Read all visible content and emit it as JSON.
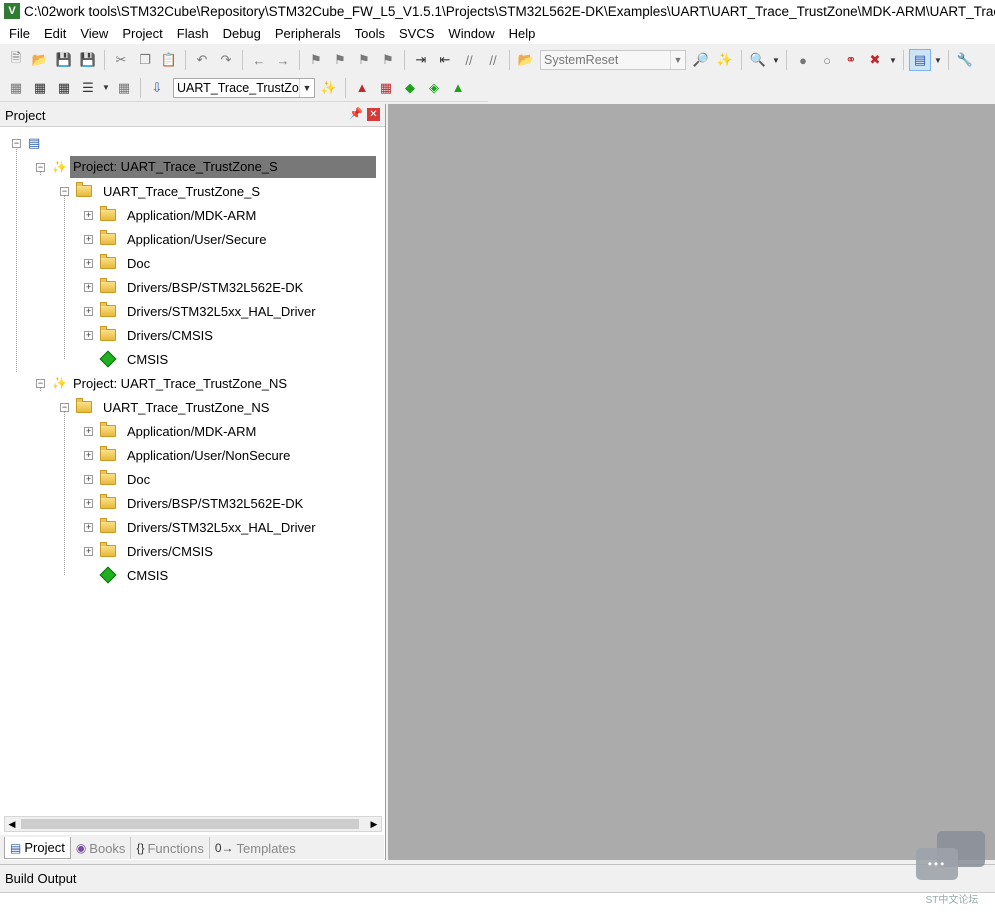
{
  "window": {
    "app_icon_letter": "V",
    "title": "C:\\02work tools\\STM32Cube\\Repository\\STM32Cube_FW_L5_V1.5.1\\Projects\\STM32L562E-DK\\Examples\\UART\\UART_Trace_TrustZone\\MDK-ARM\\UART_Trace"
  },
  "menu": [
    "File",
    "Edit",
    "View",
    "Project",
    "Flash",
    "Debug",
    "Peripherals",
    "Tools",
    "SVCS",
    "Window",
    "Help"
  ],
  "toolbar": {
    "reset_combo_value": "SystemReset",
    "target_combo_value": "UART_Trace_TrustZone"
  },
  "project_panel": {
    "title": "Project",
    "pin_icon": "pin-icon",
    "close_icon": "close-icon",
    "projects": [
      {
        "label": "Project: UART_Trace_TrustZone_S",
        "selected": true,
        "target": "UART_Trace_TrustZone_S",
        "groups": [
          "Application/MDK-ARM",
          "Application/User/Secure",
          "Doc",
          "Drivers/BSP/STM32L562E-DK",
          "Drivers/STM32L5xx_HAL_Driver",
          "Drivers/CMSIS"
        ],
        "component": "CMSIS"
      },
      {
        "label": "Project: UART_Trace_TrustZone_NS",
        "selected": false,
        "target": "UART_Trace_TrustZone_NS",
        "groups": [
          "Application/MDK-ARM",
          "Application/User/NonSecure",
          "Doc",
          "Drivers/BSP/STM32L562E-DK",
          "Drivers/STM32L5xx_HAL_Driver",
          "Drivers/CMSIS"
        ],
        "component": "CMSIS"
      }
    ],
    "tabs": [
      {
        "label": "Project",
        "icon": "project-tab-icon",
        "active": true
      },
      {
        "label": "Books",
        "icon": "books-icon",
        "active": false
      },
      {
        "label": "Functions",
        "icon": "functions-icon",
        "glyph": "{}",
        "active": false
      },
      {
        "label": "Templates",
        "icon": "templates-icon",
        "glyph": "0→",
        "active": false
      }
    ]
  },
  "build_output": {
    "title": "Build Output"
  },
  "watermark": {
    "text": "ST中文论坛"
  },
  "colors": {
    "editor_bg": "#ababab",
    "selection": "#787878",
    "component_green": "#1fb01f"
  }
}
